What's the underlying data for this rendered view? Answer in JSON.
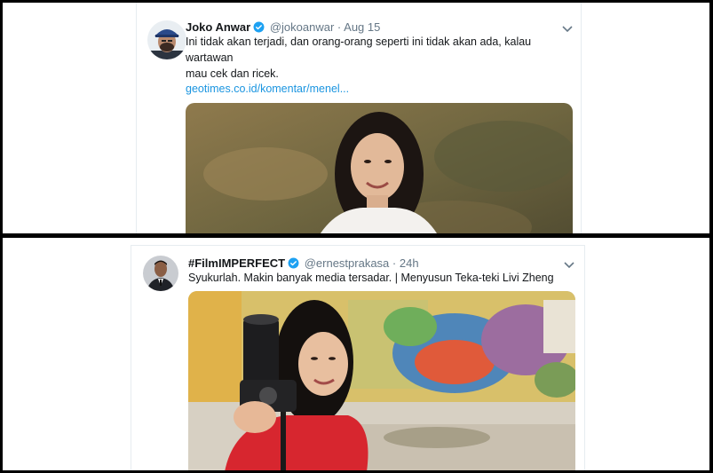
{
  "tweets": [
    {
      "name": "Joko Anwar",
      "handle": "@jokoanwar",
      "separator": "·",
      "time": "Aug 15",
      "text_line1": "Ini tidak akan terjadi, dan orang-orang seperti ini tidak akan ada, kalau wartawan",
      "text_line2": "mau cek dan ricek.",
      "link": "geotimes.co.id/komentar/menel...",
      "avatar_icon": "man-in-cap-avatar",
      "media": "photo-woman-smiling-hillside"
    },
    {
      "name": "#FilmIMPERFECT",
      "handle": "@ernestprakasa",
      "separator": "·",
      "time": "24h",
      "text_line1": "Syukurlah. Makin banyak media tersadar. | Menyusun Teka-teki Livi Zheng",
      "avatar_icon": "man-in-suit-avatar",
      "media": "photo-woman-with-camera-graffiti-wall"
    }
  ],
  "colors": {
    "verified": "#1da1f2",
    "link": "#1b95e0",
    "handle": "#657786"
  }
}
